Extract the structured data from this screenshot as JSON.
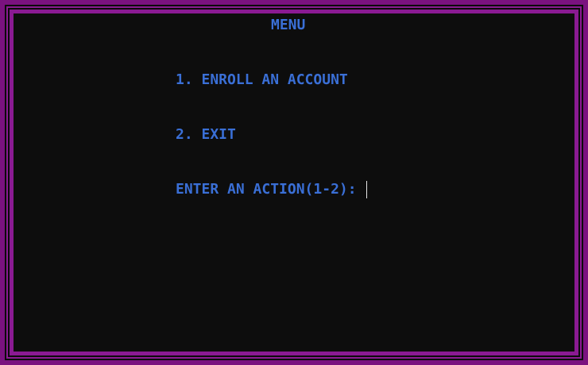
{
  "menu": {
    "title": "MENU",
    "items": [
      {
        "label": "1. ENROLL AN ACCOUNT"
      },
      {
        "label": "2. EXIT"
      }
    ],
    "prompt": "ENTER AN ACTION(1-2):",
    "input_value": ""
  },
  "colors": {
    "background": "#0d0d0d",
    "border": "#8a1a92",
    "text": "#3a6fd6",
    "cursor": "#e6e6e6"
  }
}
